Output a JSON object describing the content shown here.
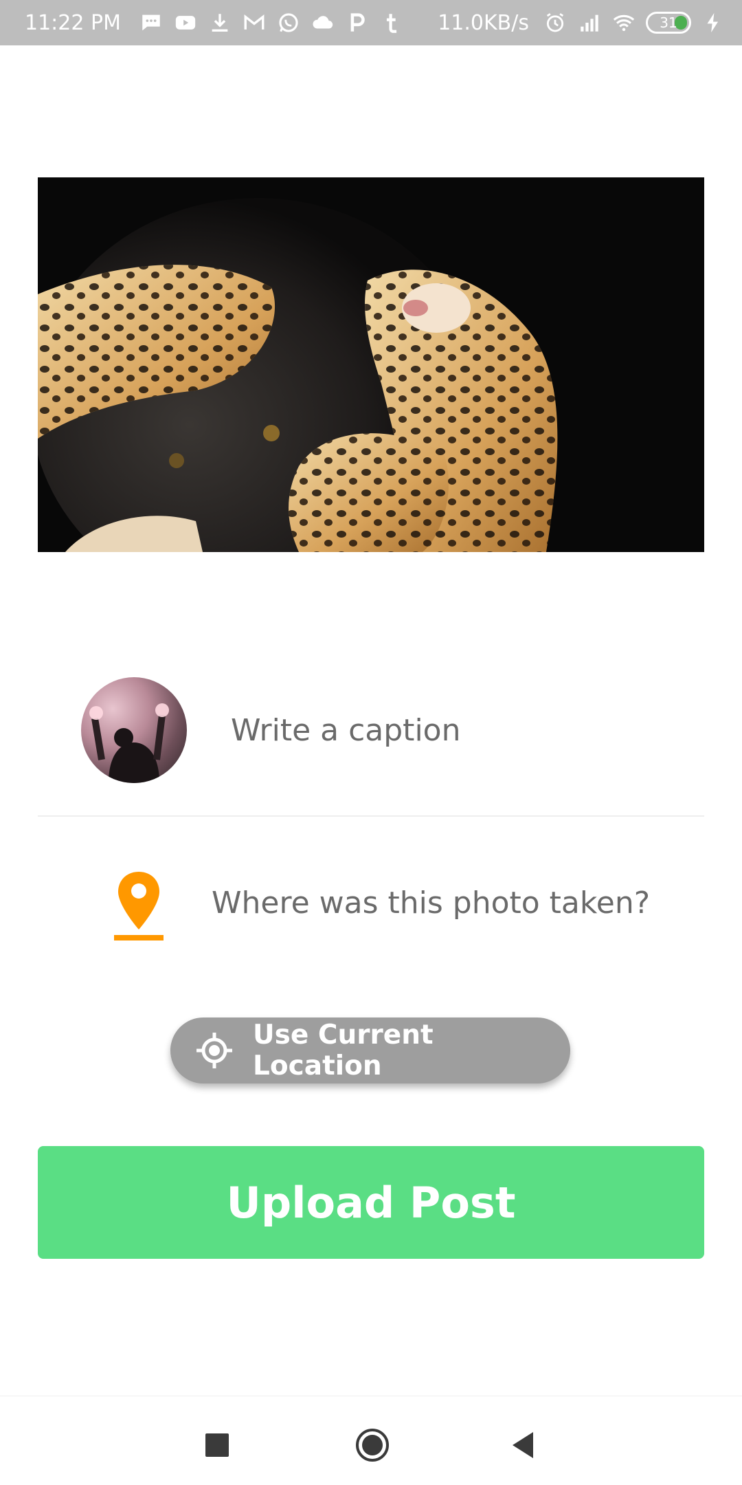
{
  "status_bar": {
    "time": "11:22 PM",
    "network_speed": "11.0KB/s",
    "battery_level": "31",
    "left_icons": [
      "message-icon",
      "youtube-icon",
      "download-icon",
      "gmail-icon",
      "whatsapp-icon",
      "cloud-icon",
      "p-app-icon",
      "tumblr-icon"
    ],
    "right_icons": [
      "alarm-icon",
      "signal-icon",
      "wifi-icon",
      "battery-icon",
      "charging-icon"
    ]
  },
  "post": {
    "image": "leopard-and-panther-photo"
  },
  "caption": {
    "placeholder": "Write a caption"
  },
  "location": {
    "placeholder": "Where was this photo taken?",
    "use_current_label": "Use Current Location"
  },
  "upload": {
    "label": "Upload Post"
  },
  "nav_bar": {
    "icons": [
      "recents-icon",
      "home-icon",
      "back-icon"
    ]
  },
  "colors": {
    "status_bar": "#bdbdbd",
    "accent_orange": "#ff9800",
    "upload_green": "#5ade84",
    "location_button_gray": "#9e9e9e",
    "placeholder_text": "#6a6a6a"
  }
}
